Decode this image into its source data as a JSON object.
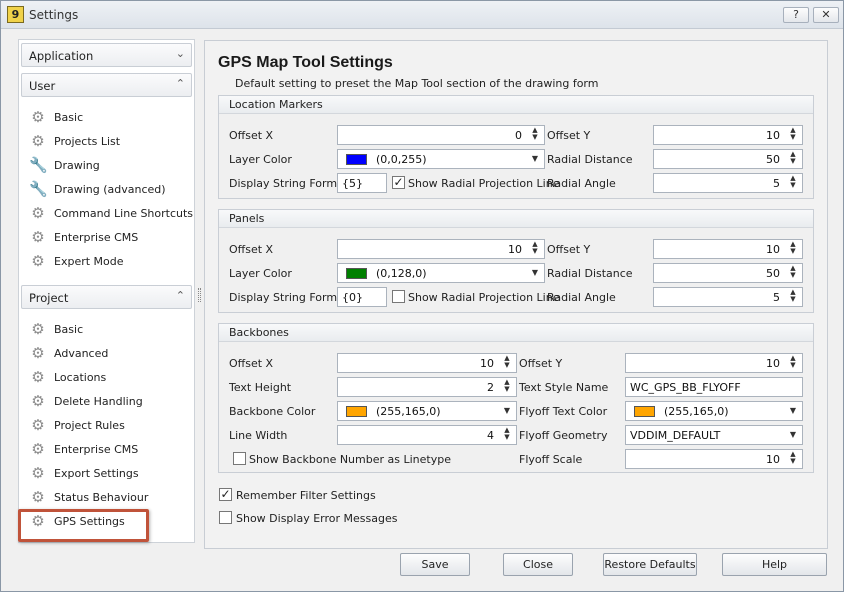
{
  "window": {
    "title": "Settings",
    "app_icon_text": "9",
    "help_glyph": "?",
    "close_glyph": "✕"
  },
  "sidebar": {
    "groups": {
      "application": "Application",
      "user": "User",
      "project": "Project"
    },
    "user_items": [
      "Basic",
      "Projects List",
      "Drawing",
      "Drawing (advanced)",
      "Command Line Shortcuts",
      "Enterprise CMS",
      "Expert Mode"
    ],
    "project_items": [
      "Basic",
      "Advanced",
      "Locations",
      "Delete Handling",
      "Project Rules",
      "Enterprise CMS",
      "Export Settings",
      "Status Behaviour",
      "GPS Settings"
    ],
    "icons": {
      "gear": "gear-icon",
      "wrench": "wrench-icon"
    }
  },
  "main": {
    "title": "GPS Map Tool Settings",
    "subtitle": "Default setting to preset the Map Tool section of the drawing form",
    "location_markers": {
      "header": "Location Markers",
      "offset_x_label": "Offset X",
      "offset_x": "0",
      "offset_y_label": "Offset Y",
      "offset_y": "10",
      "layer_color_label": "Layer Color",
      "layer_color": "(0,0,255)",
      "layer_color_hex": "#0000ff",
      "radial_distance_label": "Radial Distance",
      "radial_distance": "50",
      "display_format_label": "Display String Format",
      "display_format": "{5}",
      "show_radial_label": "Show Radial Projection Line",
      "show_radial_checked": true,
      "radial_angle_label": "Radial Angle",
      "radial_angle": "5"
    },
    "panels": {
      "header": "Panels",
      "offset_x_label": "Offset X",
      "offset_x": "10",
      "offset_y_label": "Offset Y",
      "offset_y": "10",
      "layer_color_label": "Layer Color",
      "layer_color": "(0,128,0)",
      "layer_color_hex": "#008000",
      "radial_distance_label": "Radial Distance",
      "radial_distance": "50",
      "display_format_label": "Display String Format",
      "display_format": "{0}",
      "show_radial_label": "Show Radial Projection Line",
      "show_radial_checked": false,
      "radial_angle_label": "Radial Angle",
      "radial_angle": "5"
    },
    "backbones": {
      "header": "Backbones",
      "offset_x_label": "Offset X",
      "offset_x": "10",
      "offset_y_label": "Offset Y",
      "offset_y": "10",
      "text_height_label": "Text Height",
      "text_height": "2",
      "text_style_label": "Text Style Name",
      "text_style": "WC_GPS_BB_FLYOFF",
      "backbone_color_label": "Backbone Color",
      "backbone_color": "(255,165,0)",
      "backbone_color_hex": "#ffa500",
      "flyoff_color_label": "Flyoff Text Color",
      "flyoff_color": "(255,165,0)",
      "flyoff_color_hex": "#ffa500",
      "line_width_label": "Line Width",
      "line_width": "4",
      "flyoff_geometry_label": "Flyoff Geometry",
      "flyoff_geometry": "VDDIM_DEFAULT",
      "show_backbone_label": "Show Backbone Number as Linetype",
      "show_backbone_checked": false,
      "flyoff_scale_label": "Flyoff Scale",
      "flyoff_scale": "10"
    },
    "remember_filter_label": "Remember Filter Settings",
    "remember_filter_checked": true,
    "show_errors_label": "Show Display Error Messages",
    "show_errors_checked": false
  },
  "buttons": {
    "save": "Save",
    "close": "Close",
    "restore": "Restore Defaults",
    "help": "Help"
  },
  "colors": {
    "highlight": "#c0533a"
  }
}
